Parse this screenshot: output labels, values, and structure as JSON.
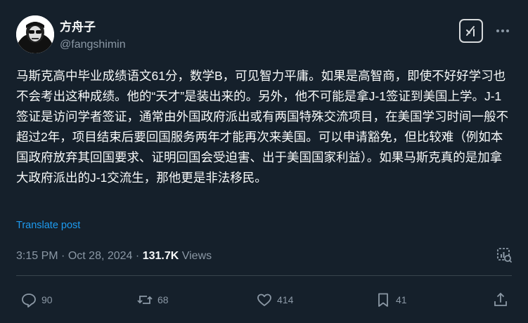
{
  "author": {
    "display_name": "方舟子",
    "handle": "@fangshimin"
  },
  "tweet": {
    "text": "马斯克高中毕业成绩语文61分，数学B，可见智力平庸。如果是高智商，即使不好好学习也不会考出这种成绩。他的“天才”是装出来的。另外，他不可能是拿J-1签证到美国上学。J-1签证是访问学者签证，通常由外国政府派出或有两国特殊交流项目，在美国学习时间一般不超过2年，项目结束后要回国服务两年才能再次来美国。可以申请豁免，但比较难（例如本国政府放弃其回国要求、证明回国会受迫害、出于美国国家利益）。如果马斯克真的是加拿大政府派出的J-1交流生，那他更是非法移民。",
    "translate_label": "Translate post",
    "time": "3:15 PM",
    "date": "Oct 28, 2024",
    "separator": "·",
    "views_count": "131.7K",
    "views_label": "Views"
  },
  "actions": {
    "replies": "90",
    "reposts": "68",
    "likes": "414",
    "bookmarks": "41"
  },
  "colors": {
    "background": "#15202b",
    "text": "#f7f9f9",
    "secondary": "#8b98a5",
    "link": "#1d9bf0"
  },
  "icons": [
    "grok-icon",
    "more-icon",
    "analytics-icon",
    "reply-icon",
    "repost-icon",
    "like-icon",
    "bookmark-icon",
    "share-icon"
  ]
}
